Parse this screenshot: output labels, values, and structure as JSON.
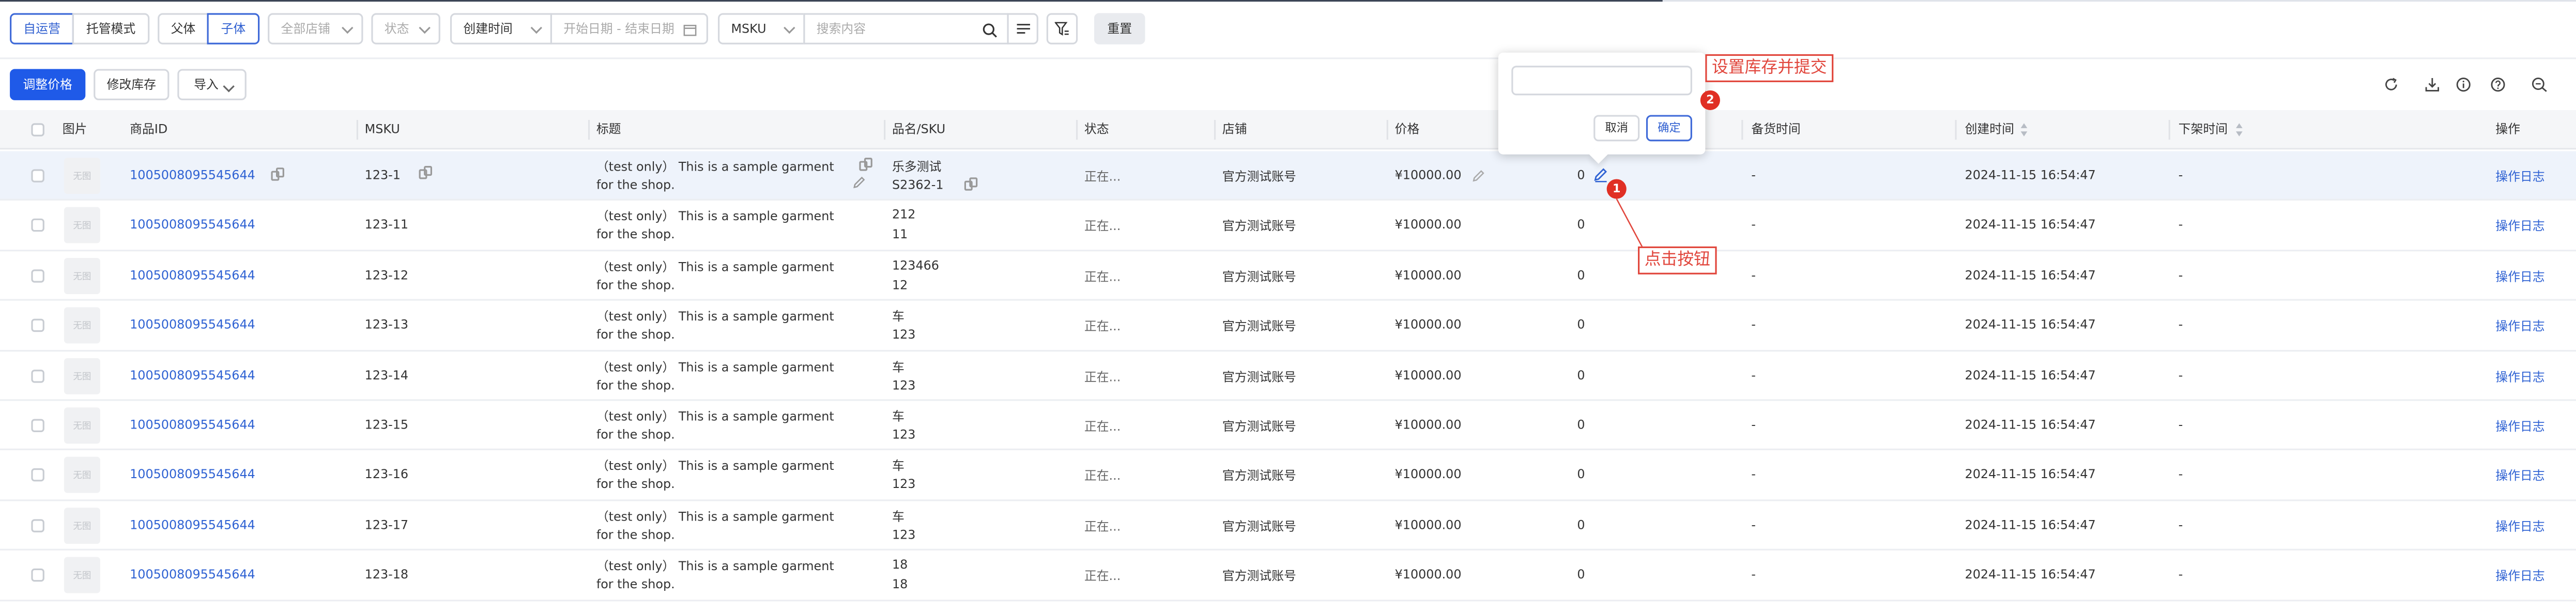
{
  "filters": {
    "mode_tabs": [
      "自运营",
      "托管模式"
    ],
    "level_tabs": [
      "父体",
      "子体"
    ],
    "store_select": "全部店铺",
    "status_select": "状态",
    "time_type_select": "创建时间",
    "date_range_placeholder": "开始日期 - 结束日期",
    "search_field_select": "MSKU",
    "search_placeholder": "搜索内容",
    "reset_label": "重置"
  },
  "toolbar": {
    "adjust_price_label": "调整价格",
    "modify_stock_label": "修改库存",
    "import_label": "导入"
  },
  "table": {
    "columns": {
      "image": "图片",
      "product_id": "商品ID",
      "msku": "MSKU",
      "title": "标题",
      "name_sku": "品名/SKU",
      "status": "状态",
      "store": "店铺",
      "price": "价格",
      "stock_time": "备货时间",
      "created_time": "创建时间",
      "delist_time": "下架时间",
      "actions": "操作"
    },
    "no_image_label": "无图",
    "rows": [
      {
        "product_id": "1005008095545644",
        "msku": "123-1",
        "title_line1": "（test only） This is a sample garment",
        "title_line2": "for the shop.",
        "name": "乐多测试",
        "sku": "S2362-1",
        "status": "正在...",
        "store": "官方测试账号",
        "price": "¥10000.00",
        "stock": "0",
        "stock_time": "-",
        "created_time": "2024-11-15 16:54:47",
        "delist_time": "-",
        "action": "操作日志"
      },
      {
        "product_id": "1005008095545644",
        "msku": "123-11",
        "title_line1": "（test only） This is a sample garment",
        "title_line2": "for the shop.",
        "name": "212",
        "sku": "11",
        "status": "正在...",
        "store": "官方测试账号",
        "price": "¥10000.00",
        "stock": "0",
        "stock_time": "-",
        "created_time": "2024-11-15 16:54:47",
        "delist_time": "-",
        "action": "操作日志"
      },
      {
        "product_id": "1005008095545644",
        "msku": "123-12",
        "title_line1": "（test only） This is a sample garment",
        "title_line2": "for the shop.",
        "name": "123466",
        "sku": "12",
        "status": "正在...",
        "store": "官方测试账号",
        "price": "¥10000.00",
        "stock": "0",
        "stock_time": "-",
        "created_time": "2024-11-15 16:54:47",
        "delist_time": "-",
        "action": "操作日志"
      },
      {
        "product_id": "1005008095545644",
        "msku": "123-13",
        "title_line1": "（test only） This is a sample garment",
        "title_line2": "for the shop.",
        "name": "车",
        "sku": "123",
        "status": "正在...",
        "store": "官方测试账号",
        "price": "¥10000.00",
        "stock": "0",
        "stock_time": "-",
        "created_time": "2024-11-15 16:54:47",
        "delist_time": "-",
        "action": "操作日志"
      },
      {
        "product_id": "1005008095545644",
        "msku": "123-14",
        "title_line1": "（test only） This is a sample garment",
        "title_line2": "for the shop.",
        "name": "车",
        "sku": "123",
        "status": "正在...",
        "store": "官方测试账号",
        "price": "¥10000.00",
        "stock": "0",
        "stock_time": "-",
        "created_time": "2024-11-15 16:54:47",
        "delist_time": "-",
        "action": "操作日志"
      },
      {
        "product_id": "1005008095545644",
        "msku": "123-15",
        "title_line1": "（test only） This is a sample garment",
        "title_line2": "for the shop.",
        "name": "车",
        "sku": "123",
        "status": "正在...",
        "store": "官方测试账号",
        "price": "¥10000.00",
        "stock": "0",
        "stock_time": "-",
        "created_time": "2024-11-15 16:54:47",
        "delist_time": "-",
        "action": "操作日志"
      },
      {
        "product_id": "1005008095545644",
        "msku": "123-16",
        "title_line1": "（test only） This is a sample garment",
        "title_line2": "for the shop.",
        "name": "车",
        "sku": "123",
        "status": "正在...",
        "store": "官方测试账号",
        "price": "¥10000.00",
        "stock": "0",
        "stock_time": "-",
        "created_time": "2024-11-15 16:54:47",
        "delist_time": "-",
        "action": "操作日志"
      },
      {
        "product_id": "1005008095545644",
        "msku": "123-17",
        "title_line1": "（test only） This is a sample garment",
        "title_line2": "for the shop.",
        "name": "车",
        "sku": "123",
        "status": "正在...",
        "store": "官方测试账号",
        "price": "¥10000.00",
        "stock": "0",
        "stock_time": "-",
        "created_time": "2024-11-15 16:54:47",
        "delist_time": "-",
        "action": "操作日志"
      },
      {
        "product_id": "1005008095545644",
        "msku": "123-18",
        "title_line1": "（test only） This is a sample garment",
        "title_line2": "for the shop.",
        "name": "18",
        "sku": "18",
        "status": "正在...",
        "store": "官方测试账号",
        "price": "¥10000.00",
        "stock": "0",
        "stock_time": "-",
        "created_time": "2024-11-15 16:54:47",
        "delist_time": "-",
        "action": "操作日志"
      }
    ]
  },
  "popover": {
    "input_value": "",
    "cancel_label": "取消",
    "confirm_label": "确定"
  },
  "annotations": {
    "step1_number": "1",
    "step1_text": "点击按钮",
    "step2_number": "2",
    "step2_text": "设置库存并提交"
  },
  "icons": [
    "refresh-icon",
    "download-icon",
    "info-icon",
    "help-icon",
    "column-settings-icon",
    "filter-icon",
    "search-icon",
    "list-icon",
    "calendar-icon",
    "copy-icon",
    "edit-icon",
    "sort-icon",
    "chevron-down-icon"
  ],
  "colors": {
    "primary": "#1f5ae8",
    "link": "#2f62d3",
    "annotation": "#e1463c",
    "row_highlight": "#eef3fb"
  }
}
